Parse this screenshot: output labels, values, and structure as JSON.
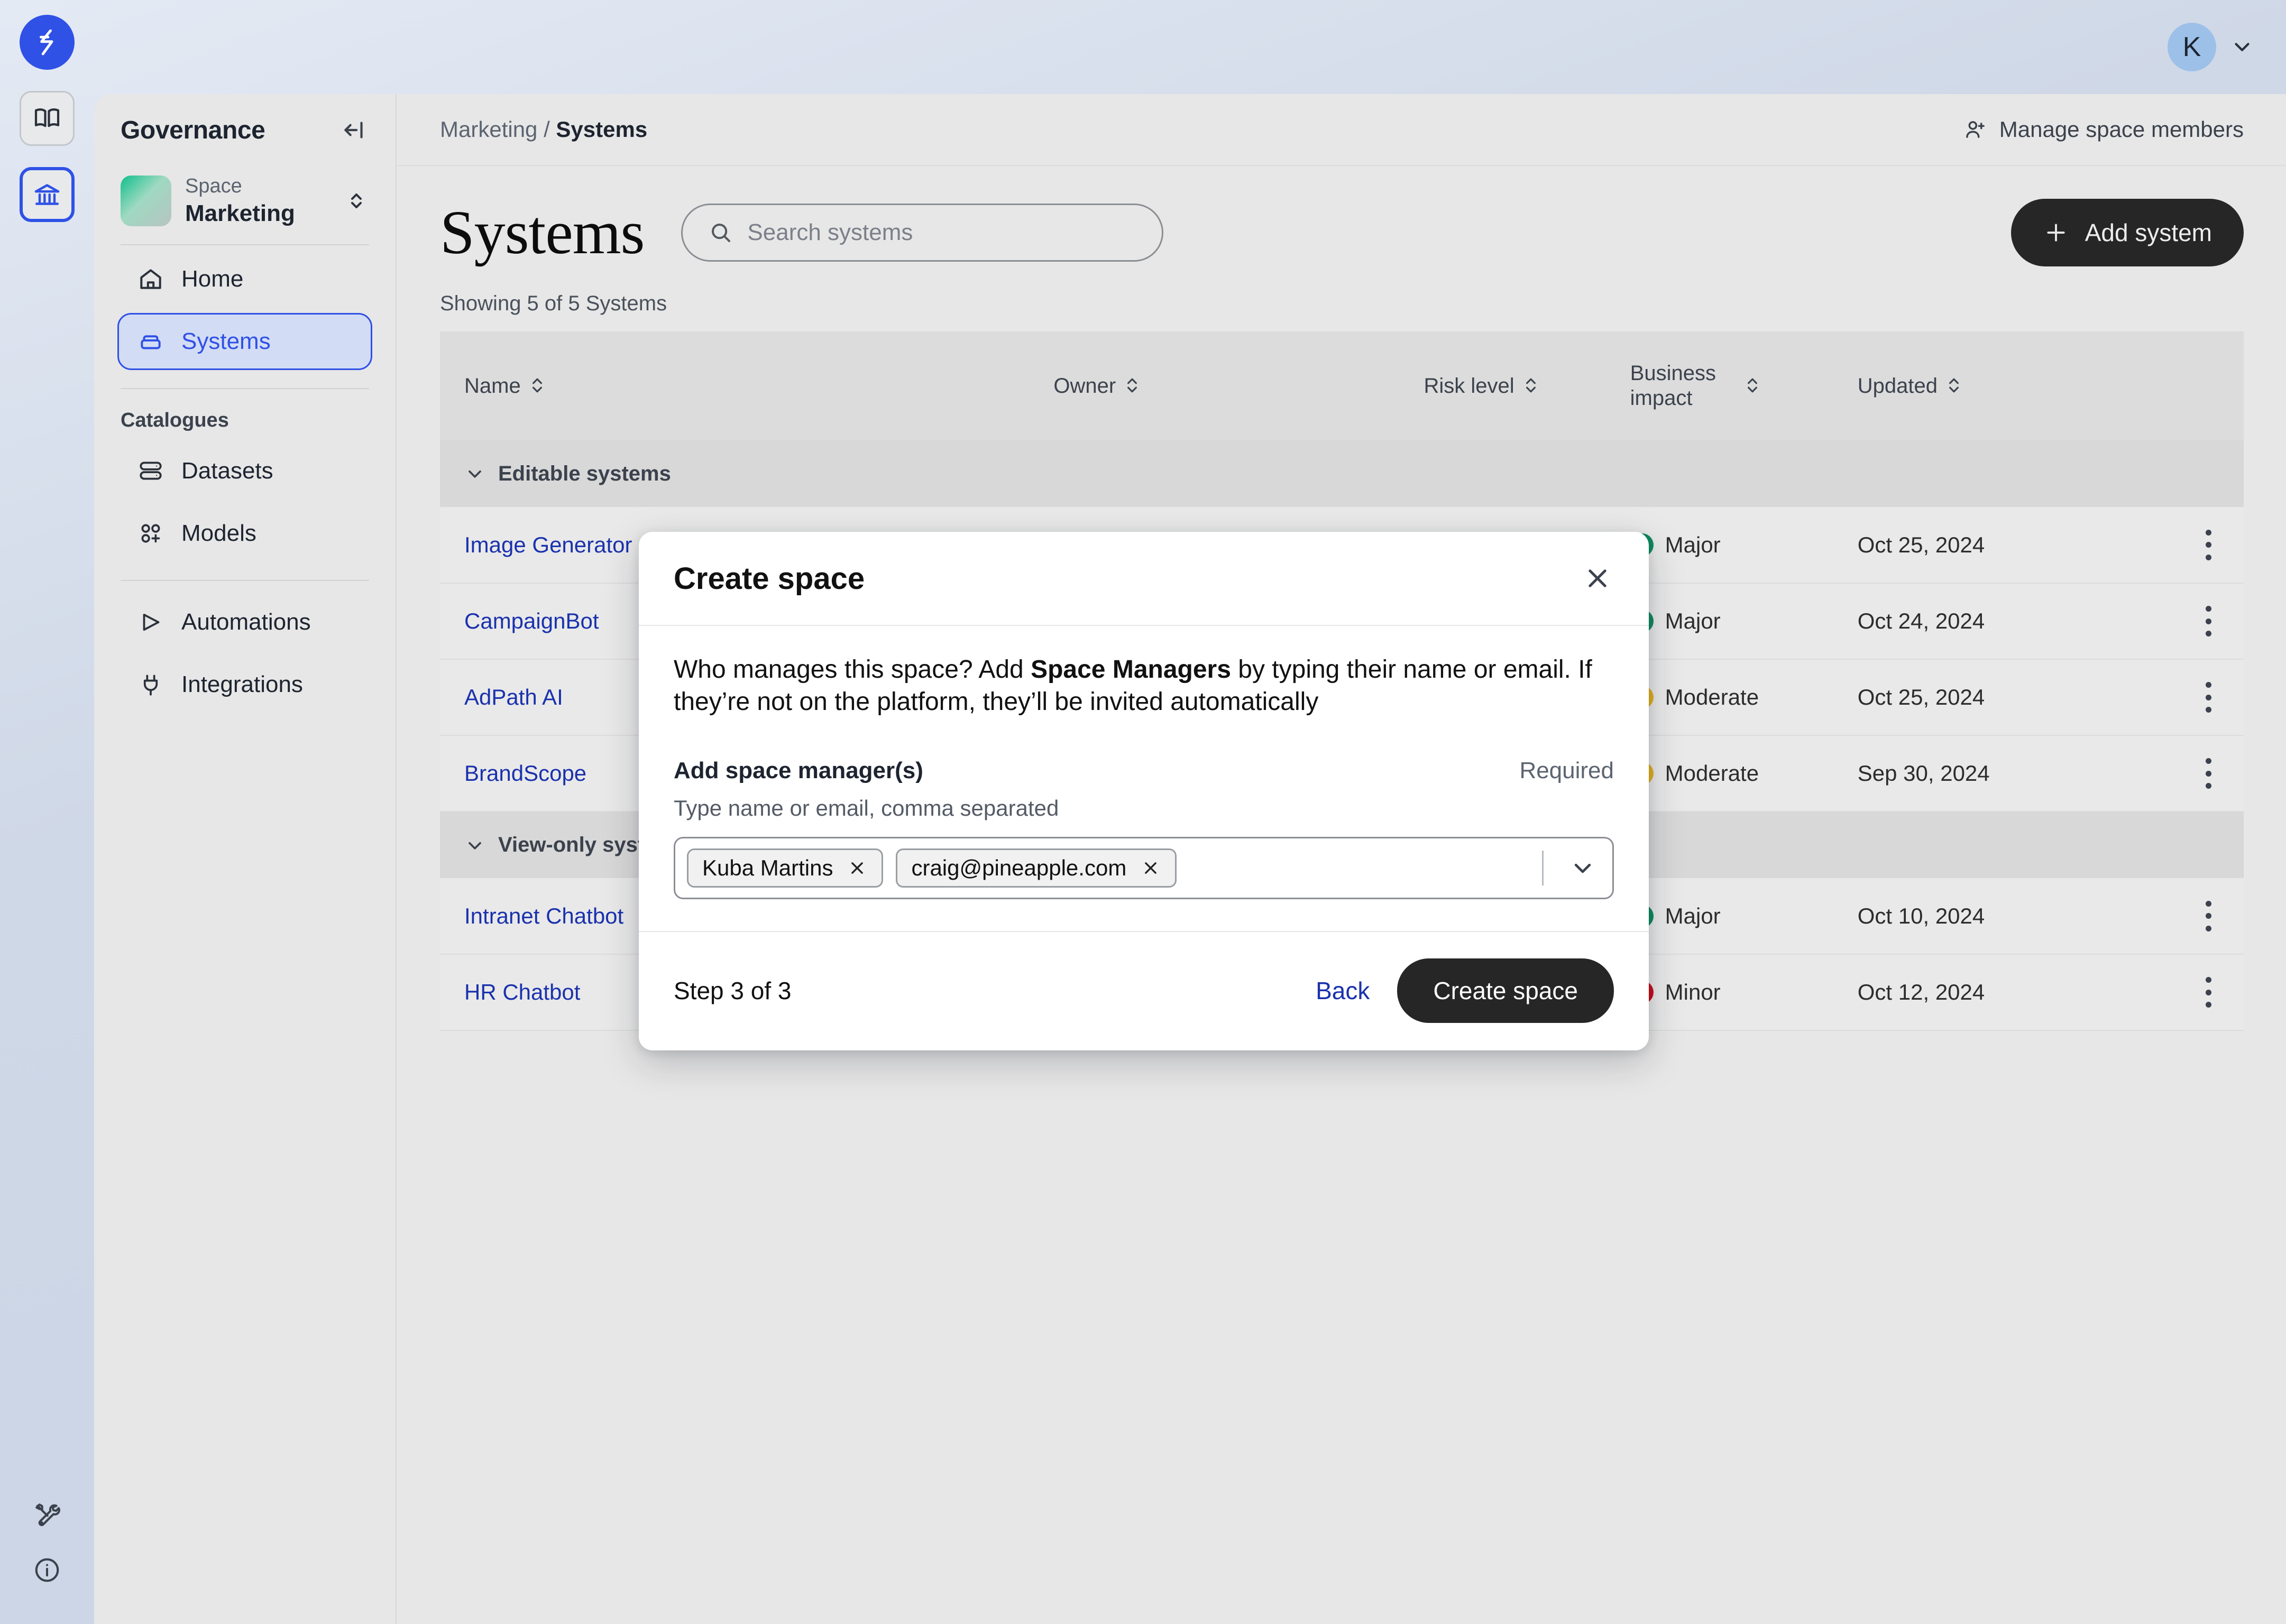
{
  "topbar": {
    "avatar_initial": "K",
    "chevron_icon": "chevron-down-icon"
  },
  "rail": {
    "logo_icon": "bolt-logo-icon",
    "items": [
      {
        "icon": "book-icon",
        "active": false
      },
      {
        "icon": "bank-icon",
        "active": true
      }
    ],
    "bottom_items": [
      {
        "icon": "tools-icon"
      },
      {
        "icon": "info-circle-icon"
      }
    ]
  },
  "sidebar": {
    "title": "Governance",
    "collapse_icon": "collapse-left-icon",
    "space": {
      "label": "Space",
      "name": "Marketing",
      "switch_icon": "chevron-up-down-icon"
    },
    "nav": [
      {
        "label": "Home",
        "icon": "home-icon",
        "active": false
      },
      {
        "label": "Systems",
        "icon": "systems-icon",
        "active": true
      }
    ],
    "section_label": "Catalogues",
    "catalogues": [
      {
        "label": "Datasets",
        "icon": "datasets-icon"
      },
      {
        "label": "Models",
        "icon": "models-icon"
      }
    ],
    "tools": [
      {
        "label": "Automations",
        "icon": "play-icon"
      },
      {
        "label": "Integrations",
        "icon": "plug-icon"
      }
    ]
  },
  "breadcrumb": {
    "parent": "Marketing",
    "separator": "/",
    "current": "Systems"
  },
  "manage_members": {
    "label": "Manage space members",
    "icon": "user-plus-icon"
  },
  "page": {
    "title": "Systems",
    "search_placeholder": "Search systems",
    "search_value": "",
    "search_icon": "search-icon",
    "add_button": "Add system",
    "add_icon": "plus-icon",
    "showing": "Showing 5 of 5 Systems"
  },
  "table": {
    "columns": [
      {
        "label": "Name",
        "sortable": true
      },
      {
        "label": "Owner",
        "sortable": true
      },
      {
        "label": "Risk level",
        "sortable": true
      },
      {
        "label": "Business impact",
        "sortable": true
      },
      {
        "label": "Updated",
        "sortable": true
      }
    ],
    "groups": [
      {
        "label": "Editable systems",
        "chevron": "chevron-down-icon",
        "rows": [
          {
            "name": "Image Generator",
            "owner": "",
            "risk": "",
            "impact": "Major",
            "impact_level": "major",
            "updated": "Oct 25, 2024"
          },
          {
            "name": "CampaignBot",
            "owner": "",
            "risk": "",
            "impact": "Major",
            "impact_level": "major",
            "updated": "Oct 24, 2024"
          },
          {
            "name": "AdPath AI",
            "owner": "",
            "risk": "",
            "impact": "Moderate",
            "impact_level": "moderate",
            "updated": "Oct 25, 2024"
          },
          {
            "name": "BrandScope",
            "owner": "",
            "risk": "",
            "impact": "Moderate",
            "impact_level": "moderate",
            "updated": "Sep 30, 2024"
          }
        ]
      },
      {
        "label": "View-only systems",
        "chevron": "chevron-down-icon",
        "rows": [
          {
            "name": "Intranet Chatbot",
            "owner": "",
            "risk": "",
            "impact": "Major",
            "impact_level": "major",
            "updated": "Oct 10, 2024"
          },
          {
            "name": "HR Chatbot",
            "owner": "",
            "risk": "",
            "impact": "Minor",
            "impact_level": "minor",
            "updated": "Oct 12, 2024"
          }
        ]
      }
    ]
  },
  "modal": {
    "title": "Create space",
    "close_icon": "close-icon",
    "description_pre": "Who manages this space? Add ",
    "description_bold": "Space Managers",
    "description_post": " by typing their name or email. If they’re not on the platform, they’ll be invited automatically",
    "field_label": "Add space manager(s)",
    "field_required": "Required",
    "field_hint": "Type name or email, comma separated",
    "tags": [
      {
        "text": "Kuba Martins",
        "remove_icon": "close-icon"
      },
      {
        "text": "craig@pineapple.com",
        "remove_icon": "close-icon"
      }
    ],
    "dropdown_icon": "chevron-down-icon",
    "step": "Step 3 of 3",
    "back": "Back",
    "submit": "Create space"
  },
  "colors": {
    "accent_blue": "#2f51e6",
    "link_blue": "#1a31ad",
    "dark_button": "#262626",
    "major_green": "#0f8a5f",
    "moderate_yellow": "#e0b020",
    "minor_red": "#c90d1b",
    "panel_bg": "#e7e7e7",
    "table_header_bg": "#dcdcdc",
    "group_row_bg": "#d8d8d8",
    "row_bg": "#e9e9e9"
  }
}
